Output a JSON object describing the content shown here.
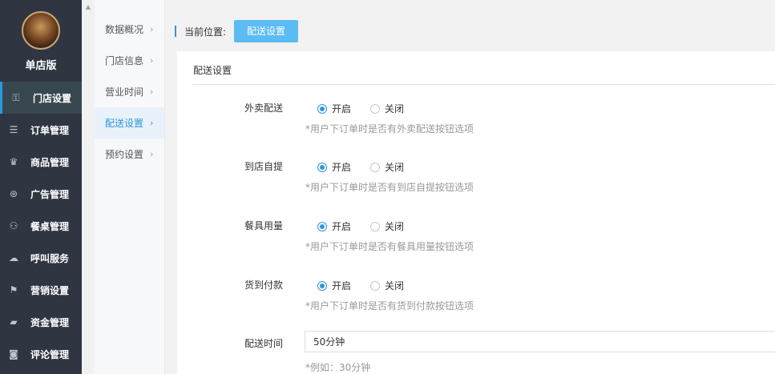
{
  "sidebar": {
    "store_name": "单店版",
    "items": [
      {
        "label": "门店设置",
        "icon": "key-icon",
        "glyph": "⚿",
        "active": true
      },
      {
        "label": "订单管理",
        "icon": "list-icon",
        "glyph": "☰",
        "active": false
      },
      {
        "label": "商品管理",
        "icon": "trophy-icon",
        "glyph": "♛",
        "active": false
      },
      {
        "label": "广告管理",
        "icon": "lifebuoy-icon",
        "glyph": "⊛",
        "active": false
      },
      {
        "label": "餐桌管理",
        "icon": "binoculars-icon",
        "glyph": "⚇",
        "active": false
      },
      {
        "label": "呼叫服务",
        "icon": "cloud-icon",
        "glyph": "☁",
        "active": false
      },
      {
        "label": "营销设置",
        "icon": "gift-icon",
        "glyph": "⚑",
        "active": false
      },
      {
        "label": "资金管理",
        "icon": "book-icon",
        "glyph": "▰",
        "active": false
      },
      {
        "label": "评论管理",
        "icon": "money-icon",
        "glyph": "◙",
        "active": false
      }
    ]
  },
  "submenu": {
    "items": [
      {
        "label": "数据概况",
        "active": false
      },
      {
        "label": "门店信息",
        "active": false
      },
      {
        "label": "营业时间",
        "active": false
      },
      {
        "label": "配送设置",
        "active": true
      },
      {
        "label": "预约设置",
        "active": false
      }
    ],
    "arrow": "›"
  },
  "breadcrumb": {
    "label": "当前位置:",
    "current": "配送设置"
  },
  "panel": {
    "title": "配送设置",
    "fields": [
      {
        "label": "外卖配送",
        "on": "开启",
        "off": "关闭",
        "selected": "on",
        "hint": "*用户下订单时是否有外卖配送按钮选项"
      },
      {
        "label": "到店自提",
        "on": "开启",
        "off": "关闭",
        "selected": "on",
        "hint": "*用户下订单时是否有到店自提按钮选项"
      },
      {
        "label": "餐具用量",
        "on": "开启",
        "off": "关闭",
        "selected": "on",
        "hint": "*用户下订单时是否有餐具用量按钮选项"
      },
      {
        "label": "货到付款",
        "on": "开启",
        "off": "关闭",
        "selected": "on",
        "hint": "*用户下订单时是否有货到付款按钮选项"
      }
    ],
    "delivery_time": {
      "label": "配送时间",
      "value": "50分钟",
      "hint": "*例如：30分钟"
    }
  },
  "colors": {
    "sidebar_bg": "#2f3541",
    "accent": "#2c97de",
    "button": "#5bbcf3"
  }
}
